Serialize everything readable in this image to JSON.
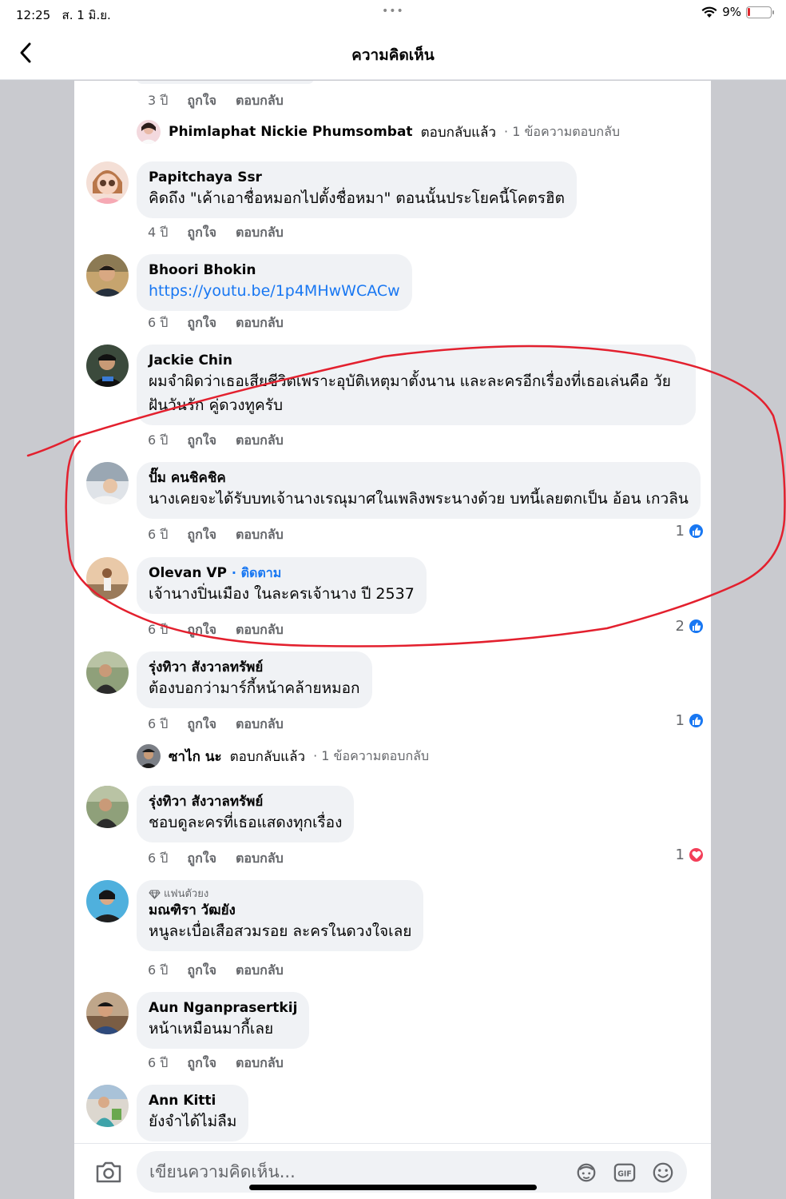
{
  "status": {
    "time": "12:25",
    "date": "ส. 1 มิ.ย.",
    "battery": "9%"
  },
  "nav": {
    "title": "ความคิดเห็น"
  },
  "actions": {
    "like": "ถูกใจ",
    "reply": "ตอบกลับ"
  },
  "comments": [
    {
      "name": "",
      "text": "",
      "age": "3 ปี"
    },
    {
      "name": "Papitchaya Ssr",
      "text": "คิดถึง \"เค้าเอาชื่อหมอกไปตั้งชื่อหมา\" ตอนนั้นประโยคนี้โคตรฮิต",
      "age": "4 ปี"
    },
    {
      "name": "Bhoori Bhokin",
      "text": "https://youtu.be/1p4MHwWCACw",
      "age": "6 ปี"
    },
    {
      "name": "Jackie Chin",
      "text": "ผมจำผิดว่าเธอเสียชีวิตเพราะอุบัติเหตุมาตั้งนาน และละครอีกเรื่องที่เธอเล่นคือ วัยฝันวันรัก คู่ดวงทูครับ",
      "age": "6 ปี"
    },
    {
      "name": "ปั๊ม คนชิคชิค",
      "text": "นางเคยจะได้รับบทเจ้านางเรณุมาศในเพลิงพระนางด้วย บทนี้เลยตกเป็น อ้อน เกวลิน",
      "age": "6 ปี",
      "reactions": "1"
    },
    {
      "name": "Olevan VP",
      "follow": "· ติดตาม",
      "text": "เจ้านางปิ่นเมือง ในละครเจ้านาง ปี 2537",
      "age": "6 ปี",
      "reactions": "2"
    },
    {
      "name": "รุ่งทิวา สังวาลทรัพย์",
      "text": "ต้องบอกว่ามาร์กี้หน้าคล้ายหมอก",
      "age": "6 ปี",
      "reactions": "1"
    },
    {
      "name": "รุ่งทิวา สังวาลทรัพย์",
      "text": "ชอบดูละครที่เธอแสดงทุกเรื่อง",
      "age": "6 ปี",
      "reactions": "1"
    },
    {
      "name": "มณฑิรา วัฒยัง",
      "badge": "แฟนตัวยง",
      "text": "หนูละเบื่อเสือสวมรอย ละครในดวงใจเลย",
      "age": "6 ปี"
    },
    {
      "name": "Aun Nganprasertkij",
      "text": "หน้าเหมือนมากี้เลย",
      "age": "6 ปี"
    },
    {
      "name": "Ann Kitti",
      "text": "ยังจำได้ไม่ลืม",
      "age": ""
    }
  ],
  "replies": [
    {
      "name": "Phimlaphat Nickie Phumsombat",
      "action": "ตอบกลับแล้ว",
      "count": "· 1 ข้อความตอบกลับ"
    },
    {
      "name": "ซาไก นะ",
      "action": "ตอบกลับแล้ว",
      "count": "· 1 ข้อความตอบกลับ"
    }
  ],
  "composer": {
    "placeholder": "เขียนความคิดเห็น..."
  },
  "icons": {
    "back": "chevron-left-icon",
    "camera": "camera-icon",
    "avatar_sticker": "avatar-sticker-icon",
    "gif": "gif-icon",
    "emoji": "smiley-icon",
    "like": "thumbs-up-icon",
    "love": "heart-icon",
    "diamond": "diamond-icon"
  },
  "colors": {
    "link": "#1877f2",
    "annotation": "#e3202e",
    "bubble": "#f0f2f5",
    "love": "#f33e58"
  }
}
